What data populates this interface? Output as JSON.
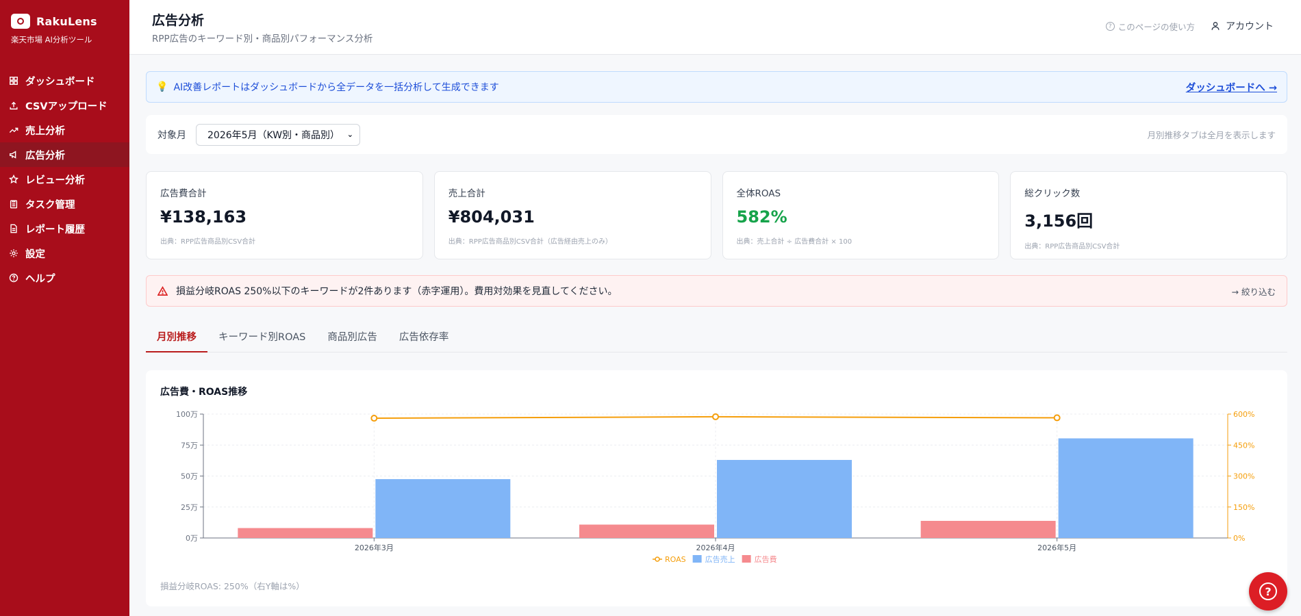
{
  "brand": {
    "name": "RakuLens",
    "subtitle": "楽天市場 AI分析ツール"
  },
  "sidebar": {
    "items": [
      {
        "label": "ダッシュボード",
        "icon": "dashboard-icon"
      },
      {
        "label": "CSVアップロード",
        "icon": "upload-icon"
      },
      {
        "label": "売上分析",
        "icon": "trend-icon"
      },
      {
        "label": "広告分析",
        "icon": "megaphone-icon",
        "active": true
      },
      {
        "label": "レビュー分析",
        "icon": "star-icon"
      },
      {
        "label": "タスク管理",
        "icon": "clipboard-icon"
      },
      {
        "label": "レポート履歴",
        "icon": "document-icon"
      },
      {
        "label": "設定",
        "icon": "gear-icon"
      },
      {
        "label": "ヘルプ",
        "icon": "help-icon"
      }
    ]
  },
  "header": {
    "title": "広告分析",
    "subtitle": "RPP広告のキーワード別・商品別パフォーマンス分析",
    "help_label": "このページの使い方",
    "account_label": "アカウント"
  },
  "info_banner": {
    "text": "AI改善レポートはダッシュボードから全データを一括分析して生成できます",
    "link": "ダッシュボードへ →"
  },
  "month_filter": {
    "label": "対象月",
    "selected": "2026年5月（KW別・商品別）",
    "note": "月別推移タブは全月を表示します"
  },
  "kpis": [
    {
      "label": "広告費合計",
      "value": "¥138,163",
      "source": "出典：RPP広告商品別CSV合計"
    },
    {
      "label": "売上合計",
      "value": "¥804,031",
      "source": "出典：RPP広告商品別CSV合計（広告経由売上のみ）"
    },
    {
      "label": "全体ROAS",
      "value": "582%",
      "source": "出典：売上合計 ÷ 広告費合計 × 100"
    },
    {
      "label": "総クリック数",
      "value": "3,156回",
      "source": "出典：RPP広告商品別CSV合計"
    }
  ],
  "alert": {
    "text": "損益分岐ROAS 250%以下のキーワードが2件あります（赤字運用）。費用対効果を見直してください。",
    "link": "→ 絞り込む"
  },
  "tabs": [
    {
      "label": "月別推移",
      "active": true
    },
    {
      "label": "キーワード別ROAS"
    },
    {
      "label": "商品別広告"
    },
    {
      "label": "広告依存率"
    }
  ],
  "chart_card": {
    "title": "広告費・ROAS推移",
    "note": "損益分岐ROAS: 250%（右Y軸は%）"
  },
  "chart_data": {
    "type": "bar",
    "categories": [
      "2026年3月",
      "2026年4月",
      "2026年5月"
    ],
    "series": [
      {
        "name": "広告費",
        "kind": "bar",
        "axis": "left",
        "color": "#f58a8e",
        "values": [
          80000,
          108000,
          138163
        ]
      },
      {
        "name": "広告売上",
        "kind": "bar",
        "axis": "left",
        "color": "#80b5f7",
        "values": [
          475000,
          630000,
          804031
        ]
      },
      {
        "name": "ROAS",
        "kind": "line",
        "axis": "right",
        "color": "#f59e0b",
        "values": [
          580,
          587,
          582
        ]
      }
    ],
    "left_axis": {
      "ticks": [
        "0万",
        "25万",
        "50万",
        "75万",
        "100万"
      ],
      "ylim": [
        0,
        1000000
      ]
    },
    "right_axis": {
      "ticks": [
        "0%",
        "150%",
        "300%",
        "450%",
        "600%"
      ],
      "ylim": [
        0,
        600
      ],
      "color": "#f59e0b"
    },
    "legend_order": [
      "ROAS",
      "広告売上",
      "広告費"
    ],
    "legend_position": "bottom-center",
    "grid": true
  }
}
